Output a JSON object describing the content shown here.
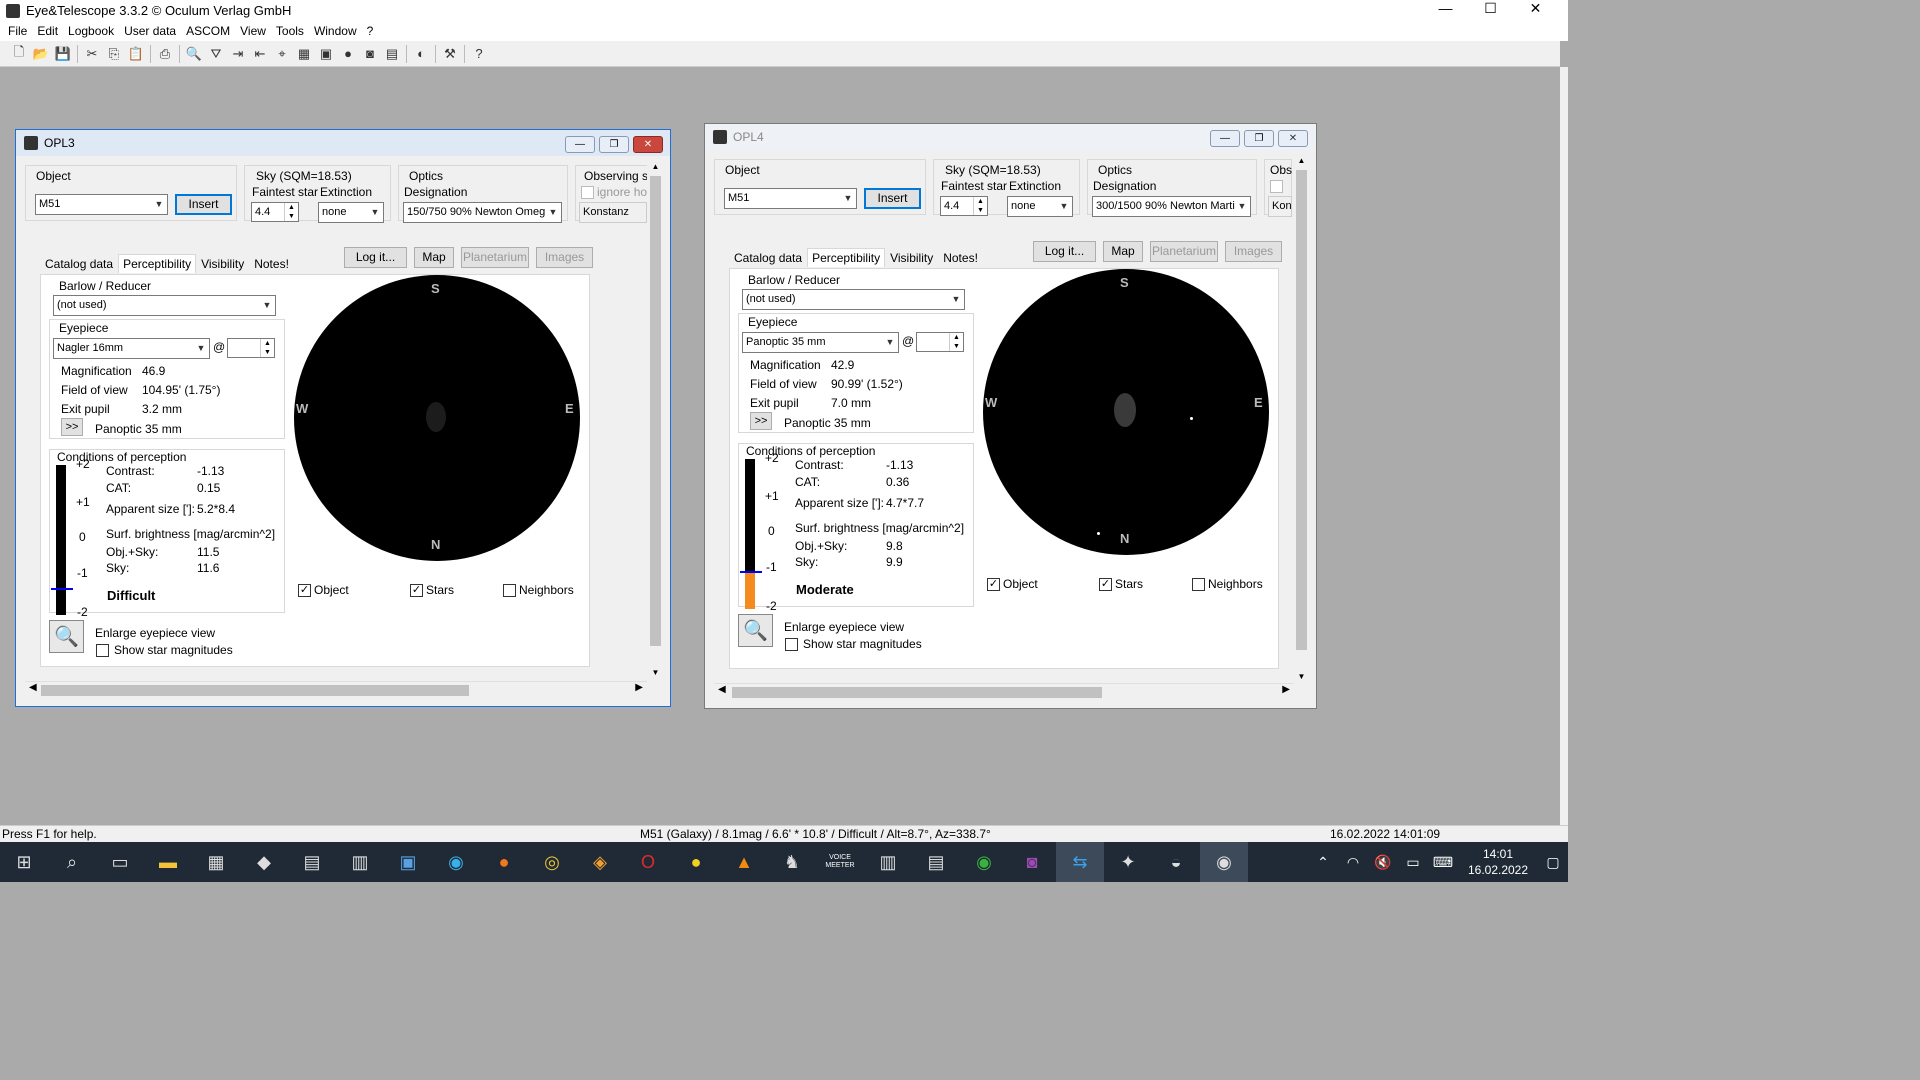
{
  "app": {
    "title": "Eye&Telescope 3.3.2 © Oculum Verlag GmbH"
  },
  "menu": [
    "File",
    "Edit",
    "Logbook",
    "User data",
    "ASCOM",
    "View",
    "Tools",
    "Window",
    "?"
  ],
  "toolbar_icons": [
    "new-icon",
    "open-icon",
    "save-icon",
    "cut-icon",
    "copy-icon",
    "paste-icon",
    "print-icon",
    "find-icon",
    "filter-icon",
    "import-icon",
    "export-icon",
    "telescope-icon",
    "chart-icon",
    "image-icon",
    "planet-icon",
    "camera-icon",
    "book-icon",
    "moon-icon",
    "tools-icon",
    "help-icon"
  ],
  "labels": {
    "object": "Object",
    "insert": "Insert",
    "sky": "Sky (SQM=18.53)",
    "faintest_star": "Faintest star",
    "extinction": "Extinction",
    "optics": "Optics",
    "designation": "Designation",
    "observing_site": "Observing sit",
    "ignore_horizon": "ignore hori",
    "tab_catalog": "Catalog data",
    "tab_perceptibility": "Perceptibility",
    "tab_visibility": "Visibility",
    "tab_notes": "Notes!",
    "log_it": "Log it...",
    "map": "Map",
    "planetarium": "Planetarium",
    "images": "Images",
    "barlow_reducer": "Barlow / Reducer",
    "eyepiece": "Eyepiece",
    "at": "@",
    "magnification": "Magnification",
    "field_of_view": "Field of view",
    "exit_pupil": "Exit pupil",
    "next_btn": ">>",
    "conditions": "Conditions of perception",
    "contrast": "Contrast:",
    "cat": "CAT:",
    "apparent_size": "Apparent size [']:",
    "surf_brightness": "Surf. brightness [mag/arcmin^2]",
    "obj_sky": "Obj.+Sky:",
    "sky_lbl": "Sky:",
    "chk_object": "Object",
    "chk_stars": "Stars",
    "chk_neighbors": "Neighbors",
    "enlarge": "Enlarge eyepiece view",
    "show_mags": "Show star magnitudes",
    "scale_ticks": [
      "+2",
      "+1",
      "0",
      "-1",
      "-2"
    ],
    "dir_s": "S",
    "dir_n": "N",
    "dir_w": "W",
    "dir_e": "E"
  },
  "windows": [
    {
      "title": "OPL3",
      "object": "M51",
      "faintest_star": "4.4",
      "extinction": "none",
      "optics": "150/750 90% Newton Omeg",
      "site": "Konstanz",
      "barlow": "(not used)",
      "eyepiece": "Nagler 16mm",
      "magnification": "46.9",
      "field_of_view": "104.95' (1.75°)",
      "exit_pupil": "3.2 mm",
      "next_eyepiece": "Panoptic 35 mm",
      "contrast": "-1.13",
      "cat": "0.15",
      "apparent_size": "5.2*8.4",
      "obj_sky": "11.5",
      "sky": "11.6",
      "verdict": "Difficult",
      "perception_level": -1.3,
      "chk_object": true,
      "chk_stars": true,
      "chk_neighbors": false,
      "chk_show_mags": false
    },
    {
      "title": "OPL4",
      "object": "M51",
      "faintest_star": "4.4",
      "extinction": "none",
      "optics": "300/1500 90% Newton Marti",
      "site": "Kon",
      "barlow": "(not used)",
      "eyepiece": "Panoptic 35 mm",
      "magnification": "42.9",
      "field_of_view": "90.99' (1.52°)",
      "exit_pupil": "7.0 mm",
      "next_eyepiece": "Panoptic 35 mm",
      "contrast": "-1.13",
      "cat": "0.36",
      "apparent_size": "4.7*7.7",
      "obj_sky": "9.8",
      "sky": "9.9",
      "verdict": "Moderate",
      "perception_level": -1.0,
      "chk_object": true,
      "chk_stars": true,
      "chk_neighbors": false,
      "chk_show_mags": false
    }
  ],
  "status": {
    "help": "Press F1 for help.",
    "object_info": "M51 (Galaxy) / 8.1mag / 6.6' * 10.8' / Difficult / Alt=8.7°, Az=338.7°",
    "datetime": "16.02.2022 14:01:09"
  },
  "taskbar": {
    "apps": [
      "start-icon",
      "search-icon",
      "task-view-icon",
      "file-explorer-icon",
      "store-icon",
      "app-icon",
      "app-icon",
      "app-icon",
      "app-icon",
      "edge-icon",
      "firefox-icon",
      "chrome-icon",
      "brave-icon",
      "opera-icon",
      "app-icon",
      "vlc-icon",
      "app-icon",
      "voicemeeter-icon",
      "app-icon",
      "app-icon",
      "app-icon",
      "app-icon",
      "teamviewer-icon",
      "app-icon",
      "app-icon",
      "eye-telescope-icon"
    ],
    "voicemeeter_label": "VOICE MEETER",
    "time": "14:01",
    "date": "16.02.2022"
  },
  "colors": {
    "scale_fill": "#f58a1f",
    "marker": "#0000ff",
    "active_border": "#1e6fd9"
  }
}
